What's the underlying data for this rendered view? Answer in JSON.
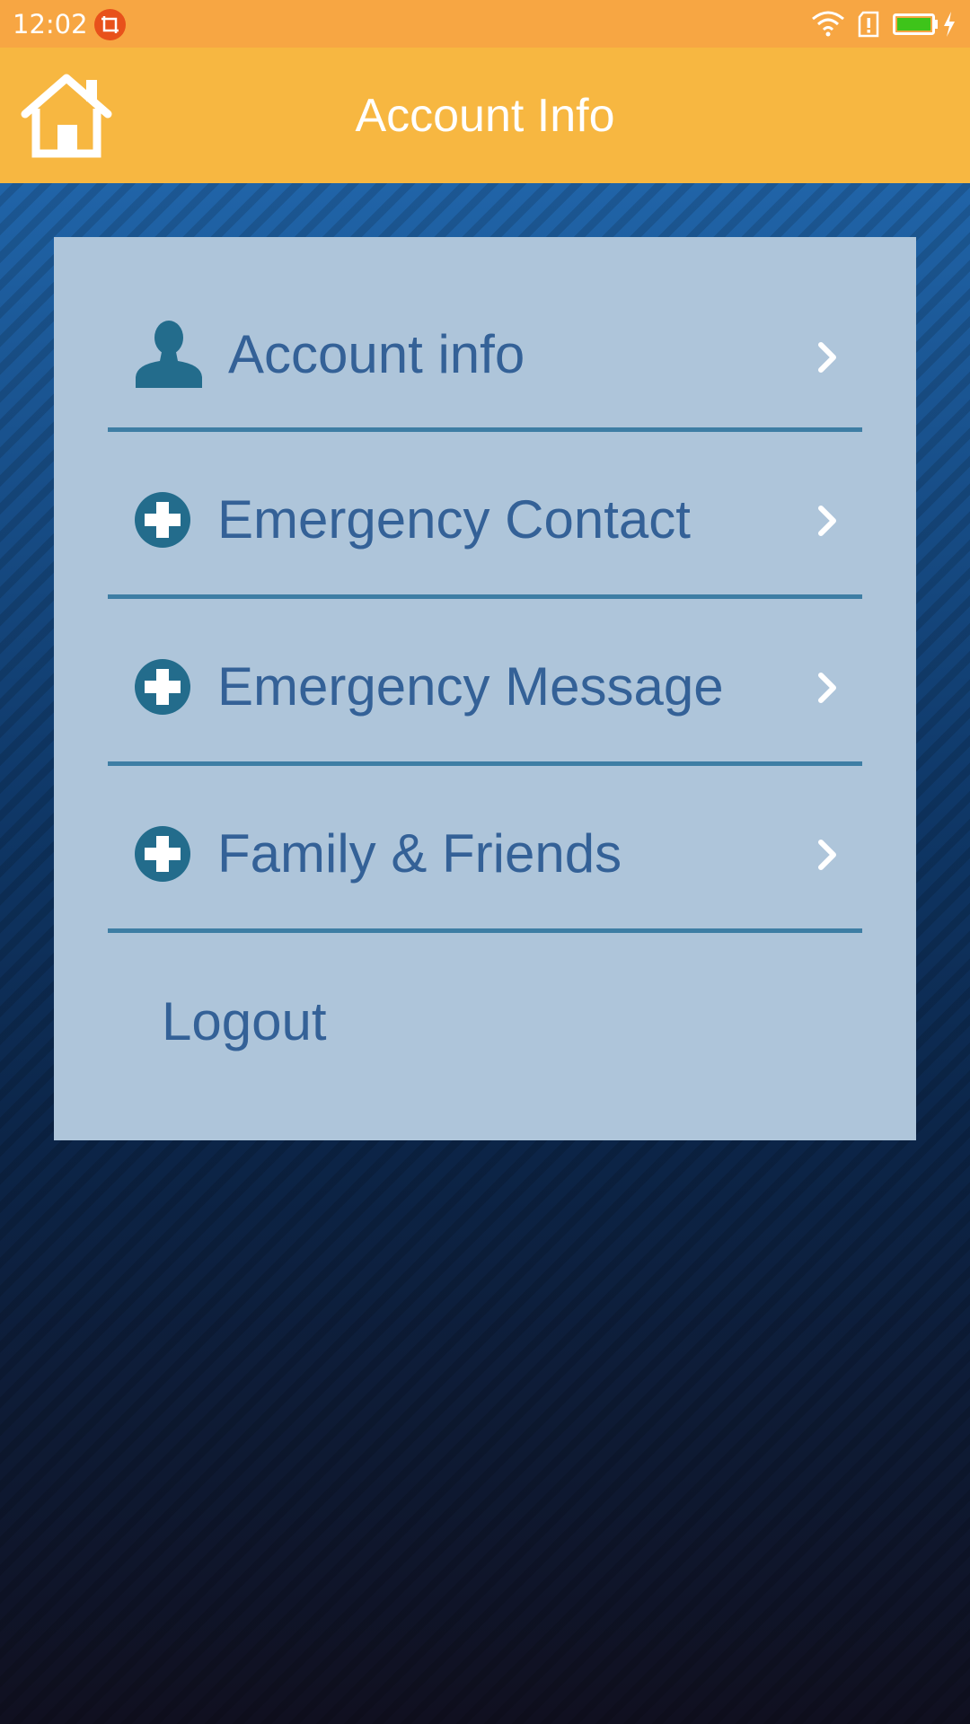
{
  "status_bar": {
    "time": "12:02"
  },
  "app_bar": {
    "title": "Account Info"
  },
  "menu": {
    "items": [
      {
        "label": "Account info",
        "icon": "person-icon"
      },
      {
        "label": "Emergency Contact",
        "icon": "plus-circle-icon"
      },
      {
        "label": "Emergency Message",
        "icon": "plus-circle-icon"
      },
      {
        "label": "Family & Friends",
        "icon": "plus-circle-icon"
      }
    ],
    "logout_label": "Logout"
  },
  "colors": {
    "status_bar": "#f7a643",
    "app_bar": "#f7b741",
    "card": "#aec5da",
    "text": "#346197",
    "icon": "#236c8c",
    "divider": "#3e7ea4"
  }
}
